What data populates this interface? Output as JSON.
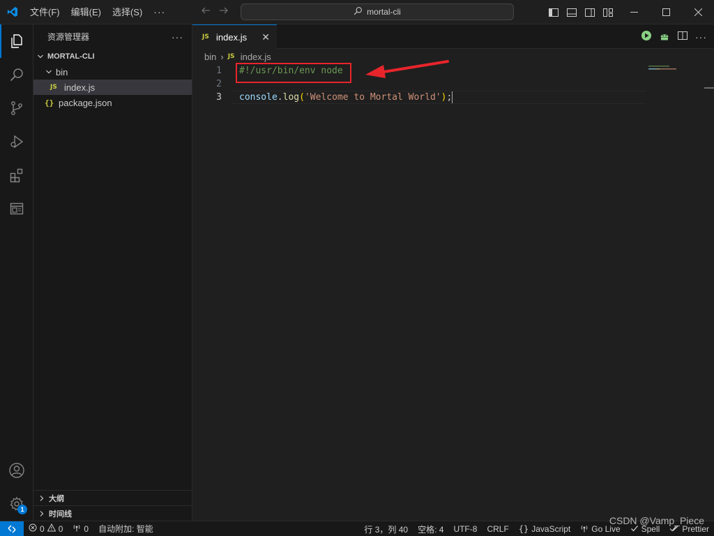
{
  "menu": {
    "items": [
      "文件(F)",
      "编辑(E)",
      "选择(S)"
    ],
    "more": "···"
  },
  "command_center": {
    "text": "mortal-cli"
  },
  "activity_bar": {
    "items": [
      "files-icon",
      "search-icon",
      "source-control-icon",
      "run-debug-icon",
      "extensions-icon",
      "remote-explorer-icon"
    ],
    "account_icon": "account-icon",
    "settings_icon": "gear-icon",
    "settings_badge": "1"
  },
  "sidebar": {
    "title": "资源管理器",
    "more": "···",
    "project": "MORTAL-CLI",
    "folder": "bin",
    "files": [
      {
        "icon": "JS",
        "name": "index.js"
      },
      {
        "icon": "{}",
        "name": "package.json"
      }
    ],
    "panels": [
      "大纲",
      "时间线"
    ]
  },
  "editor": {
    "tab": {
      "icon": "JS",
      "label": "index.js",
      "close": "✕"
    },
    "breadcrumb": {
      "folder": "bin",
      "sep": "›",
      "file_icon": "JS",
      "file": "index.js"
    },
    "lines": [
      {
        "num": "1",
        "text": "#!/usr/bin/env node"
      },
      {
        "num": "2",
        "text": ""
      },
      {
        "num": "3",
        "ident": "console",
        "dot": ".",
        "fn": "log",
        "open": "(",
        "str": "'Welcome to Mortal World'",
        "close": ")",
        "semi": ";"
      }
    ]
  },
  "statusbar": {
    "errors": "0",
    "warnings": "0",
    "ports": "0",
    "auto_attach": "自动附加: 智能",
    "position": "行 3，列 40",
    "spaces": "空格: 4",
    "encoding": "UTF-8",
    "eol": "CRLF",
    "language": "JavaScript",
    "go_live": "Go Live",
    "spell": "Spell",
    "prettier": "Prettier"
  },
  "watermark": "CSDN @Vamp_Piece",
  "colors": {
    "accent": "#0078d4",
    "annotation": "#e8252b",
    "comment": "#6a9955",
    "string": "#ce9178",
    "function": "#dcdcaa",
    "variable": "#9cdcfe",
    "run": "#89d185"
  }
}
